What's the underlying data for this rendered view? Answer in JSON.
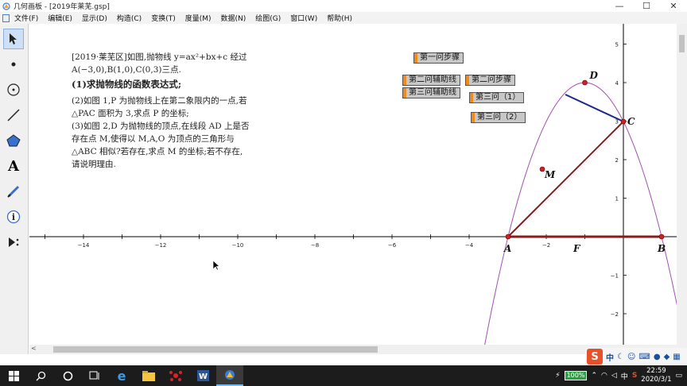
{
  "window": {
    "title": "几何画板 - [2019年莱芜.gsp]",
    "minimize_label": "—",
    "maximize_label": "☐",
    "close_label": "✕"
  },
  "menu": [
    "文件(F)",
    "编辑(E)",
    "显示(D)",
    "构造(C)",
    "变换(T)",
    "度量(M)",
    "数据(N)",
    "绘图(G)",
    "窗口(W)",
    "帮助(H)"
  ],
  "tools": [
    "arrow-select-tool",
    "point-tool",
    "compass-tool",
    "straightedge-tool",
    "polygon-tool",
    "text-tool",
    "marker-tool",
    "info-tool",
    "custom-tool"
  ],
  "problem": {
    "line1": "[2019·莱芜区]如图,抛物线 y=ax²+bx+c 经过",
    "line2": "A(−3,0),B(1,0),C(0,3)三点.",
    "q1": "(1)求抛物线的函数表达式;",
    "q2a": "(2)如图 1,P 为抛物线上在第二象限内的一点,若",
    "q2b": "△PAC 面积为 3,求点 P 的坐标;",
    "q3a": "(3)如图 2,D 为抛物线的顶点,在线段 AD 上是否",
    "q3b": "存在点 M,使得以 M,A,O 为顶点的三角形与",
    "q3c": "△ABC 相似?若存在,求点 M 的坐标;若不存在,",
    "q3d": "请说明理由."
  },
  "buttons": {
    "step1": "第一问步骤",
    "aux2": "第二问辅助线",
    "step2": "第二问步骤",
    "aux3": "第三问辅助线",
    "step3_1": "第三问（1）",
    "step3_2": "第三问（2）"
  },
  "graph": {
    "x_ticks": [
      "−14",
      "−12",
      "−10",
      "−8",
      "−6",
      "−4",
      "−2"
    ],
    "y_ticks": [
      "5",
      "4",
      "3",
      "2",
      "1",
      "−1",
      "−2"
    ],
    "point_labels": {
      "A": "A",
      "B": "B",
      "C": "C",
      "D": "D",
      "F": "F",
      "M": "M"
    },
    "colors": {
      "parabola": "#a050b0",
      "segment": "#8b1a1a",
      "blue_segment": "#1a2a8b",
      "point": "#d02020",
      "axis": "#000000"
    }
  },
  "ime": {
    "lang": "中",
    "icons": [
      "moon",
      "smile",
      "keyboard",
      "mic",
      "skin",
      "grid",
      "more"
    ]
  },
  "taskbar": {
    "apps": [
      "start",
      "search",
      "taskview",
      "edge",
      "explorer",
      "mindmap",
      "word",
      "geometer"
    ],
    "battery": "100%",
    "lang": "中",
    "time": "22:59",
    "date": "2020/3/1"
  }
}
